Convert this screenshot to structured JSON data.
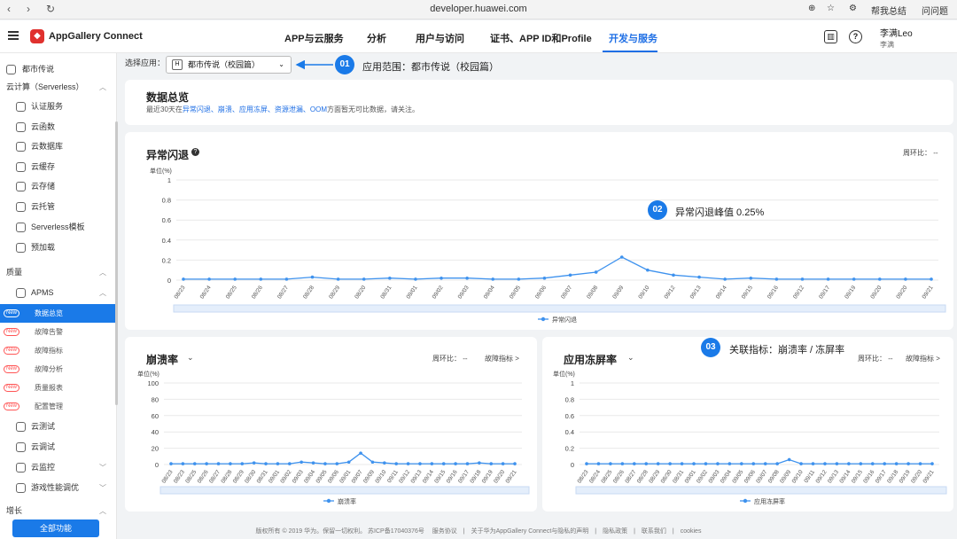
{
  "browser": {
    "url": "developer.huawei.com",
    "right1": "帮我总结",
    "right2": "问问题"
  },
  "app": {
    "brand": "AppGallery Connect",
    "nav": [
      "APP与云服务",
      "分析",
      "用户与访问",
      "证书、APP ID和Profile",
      "开发与服务"
    ],
    "active_nav": "开发与服务",
    "user_name": "李满Leo",
    "user_sub": "李满"
  },
  "sidebar": {
    "items": [
      {
        "label": "都市传说",
        "kind": "top"
      },
      {
        "label": "云计算（Serverless）",
        "kind": "group",
        "arrow": "^"
      },
      {
        "label": "认证服务",
        "kind": "item"
      },
      {
        "label": "云函数",
        "kind": "item"
      },
      {
        "label": "云数据库",
        "kind": "item"
      },
      {
        "label": "云缓存",
        "kind": "item"
      },
      {
        "label": "云存储",
        "kind": "item"
      },
      {
        "label": "云托管",
        "kind": "item"
      },
      {
        "label": "Serverless模板",
        "kind": "item"
      },
      {
        "label": "预加载",
        "kind": "item"
      },
      {
        "label": "质量",
        "kind": "group",
        "arrow": "^"
      },
      {
        "label": "APMS",
        "kind": "item",
        "arrow": "^"
      },
      {
        "label": "数据总览",
        "kind": "sub",
        "new": true,
        "selected": true
      },
      {
        "label": "故障告警",
        "kind": "sub",
        "new": true
      },
      {
        "label": "故障指标",
        "kind": "sub",
        "new": true
      },
      {
        "label": "故障分析",
        "kind": "sub",
        "new": true
      },
      {
        "label": "质量报表",
        "kind": "sub",
        "new": true
      },
      {
        "label": "配置管理",
        "kind": "sub",
        "new": true
      },
      {
        "label": "云测试",
        "kind": "item"
      },
      {
        "label": "云调试",
        "kind": "item"
      },
      {
        "label": "云监控",
        "kind": "item",
        "arrow": "v"
      },
      {
        "label": "游戏性能调优",
        "kind": "item",
        "arrow": "v"
      },
      {
        "label": "增长",
        "kind": "group",
        "arrow": "^"
      }
    ],
    "new_label": "New",
    "all_button": "全部功能"
  },
  "selector": {
    "label": "选择应用：",
    "value": "都市传说（校园篇）",
    "badge": "H"
  },
  "annotations": [
    {
      "num": "01",
      "text": "应用范围：都市传说（校园篇）"
    },
    {
      "num": "02",
      "text": "异常闪退峰值 0.25%"
    },
    {
      "num": "03",
      "text": "关联指标：崩溃率 / 冻屏率"
    }
  ],
  "overview": {
    "title": "数据总览",
    "desc_prefix": "最近30天在",
    "links": "异常闪退、崩溃、应用冻屏、资源泄漏、OOM",
    "desc_suffix": "方面暂无可比数据，请关注。"
  },
  "cards": {
    "mom_label": "周环比：",
    "mom_value": "--",
    "fault_link": "故障指标 >",
    "unit": "单位(%)",
    "main_title": "异常闪退",
    "crash_title": "崩溃率",
    "freeze_title": "应用冻屏率"
  },
  "footer": {
    "text": "版权所有 © 2019 华为。保留一切权利。 苏ICP备17040376号 　服务协议　|　关于华为AppGallery Connect与隐私的声明　|　隐私政策　|　联系我们　|　cookies"
  },
  "chart_data": [
    {
      "type": "line",
      "title": "异常闪退",
      "ylabel": "单位(%)",
      "ylim": [
        0,
        1
      ],
      "yticks": [
        "1",
        "0.8",
        "0.6",
        "0.4",
        "0.2",
        "0"
      ],
      "x": [
        "08/23",
        "08/24",
        "08/25",
        "08/26",
        "08/27",
        "08/28",
        "08/29",
        "08/20",
        "08/31",
        "09/01",
        "09/02",
        "09/03",
        "09/04",
        "09/05",
        "09/06",
        "09/07",
        "09/08",
        "09/09",
        "09/10",
        "09/12",
        "09/13",
        "09/14",
        "09/15",
        "09/16",
        "09/12",
        "09/17",
        "09/19",
        "09/20",
        "09/20",
        "09/21"
      ],
      "series": [
        {
          "name": "异常闪退",
          "values": [
            0.01,
            0.01,
            0.01,
            0.01,
            0.01,
            0.03,
            0.01,
            0.01,
            0.02,
            0.01,
            0.02,
            0.02,
            0.01,
            0.01,
            0.02,
            0.05,
            0.08,
            0.23,
            0.1,
            0.05,
            0.03,
            0.01,
            0.02,
            0.01,
            0.01,
            0.01,
            0.01,
            0.01,
            0.01,
            0.01
          ]
        }
      ]
    },
    {
      "type": "line",
      "title": "崩溃率",
      "ylabel": "单位(%)",
      "ylim": [
        0,
        100
      ],
      "yticks": [
        "100",
        "80",
        "60",
        "40",
        "20",
        "0"
      ],
      "x": [
        "08/23",
        "08/23",
        "08/25",
        "08/26",
        "08/27",
        "08/28",
        "08/29",
        "08/30",
        "08/31",
        "09/01",
        "09/02",
        "09/03",
        "09/04",
        "09/05",
        "09/06",
        "09/01",
        "09/07",
        "09/09",
        "09/10",
        "09/11",
        "09/12",
        "09/13",
        "09/14",
        "09/15",
        "09/16",
        "09/17",
        "09/18",
        "09/19",
        "09/20",
        "09/21"
      ],
      "series": [
        {
          "name": "崩溃率",
          "values": [
            1,
            1,
            1,
            1,
            1,
            1,
            1,
            2,
            1,
            1,
            1,
            3,
            2,
            1,
            1,
            3,
            14,
            3,
            2,
            1,
            1,
            1,
            1,
            1,
            1,
            1,
            2,
            1,
            1,
            1
          ]
        }
      ]
    },
    {
      "type": "line",
      "title": "应用冻屏率",
      "ylabel": "单位(%)",
      "ylim": [
        0,
        1
      ],
      "yticks": [
        "1",
        "0.8",
        "0.6",
        "0.4",
        "0.2",
        "0"
      ],
      "x": [
        "08/23",
        "08/24",
        "08/25",
        "08/26",
        "08/27",
        "08/28",
        "08/29",
        "08/30",
        "08/31",
        "09/01",
        "09/02",
        "09/03",
        "09/04",
        "09/05",
        "09/06",
        "09/07",
        "09/08",
        "09/09",
        "09/10",
        "09/11",
        "09/12",
        "09/13",
        "09/14",
        "09/15",
        "09/16",
        "09/17",
        "09/18",
        "09/19",
        "09/20",
        "09/21"
      ],
      "series": [
        {
          "name": "应用冻屏率",
          "values": [
            0.01,
            0.01,
            0.01,
            0.01,
            0.01,
            0.01,
            0.01,
            0.01,
            0.01,
            0.01,
            0.01,
            0.01,
            0.01,
            0.01,
            0.01,
            0.01,
            0.01,
            0.06,
            0.01,
            0.01,
            0.01,
            0.01,
            0.01,
            0.01,
            0.01,
            0.01,
            0.01,
            0.01,
            0.01,
            0.01
          ]
        }
      ]
    }
  ]
}
